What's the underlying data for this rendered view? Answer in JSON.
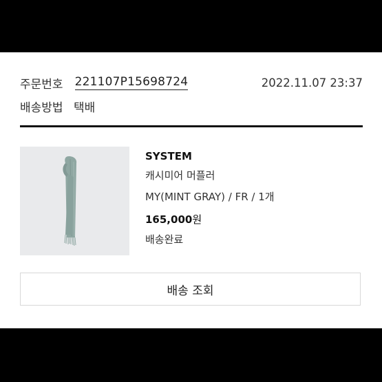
{
  "order": {
    "label": "주문번호",
    "number": "221107P15698724",
    "datetime": "2022.11.07 23:37"
  },
  "shipping": {
    "label": "배송방법",
    "method": "택배"
  },
  "product": {
    "image_icon": "mint-gray-scarf-icon",
    "brand": "SYSTEM",
    "name": "캐시미어 머플러",
    "option": "MY(MINT GRAY) / FR / 1개",
    "price": "165,000",
    "currency": "원",
    "status": "배송완료"
  },
  "actions": {
    "track_label": "배송 조회"
  },
  "colors": {
    "scarf": "#8fa7a2",
    "image_bg": "#e9eaec",
    "divider": "#111111"
  }
}
